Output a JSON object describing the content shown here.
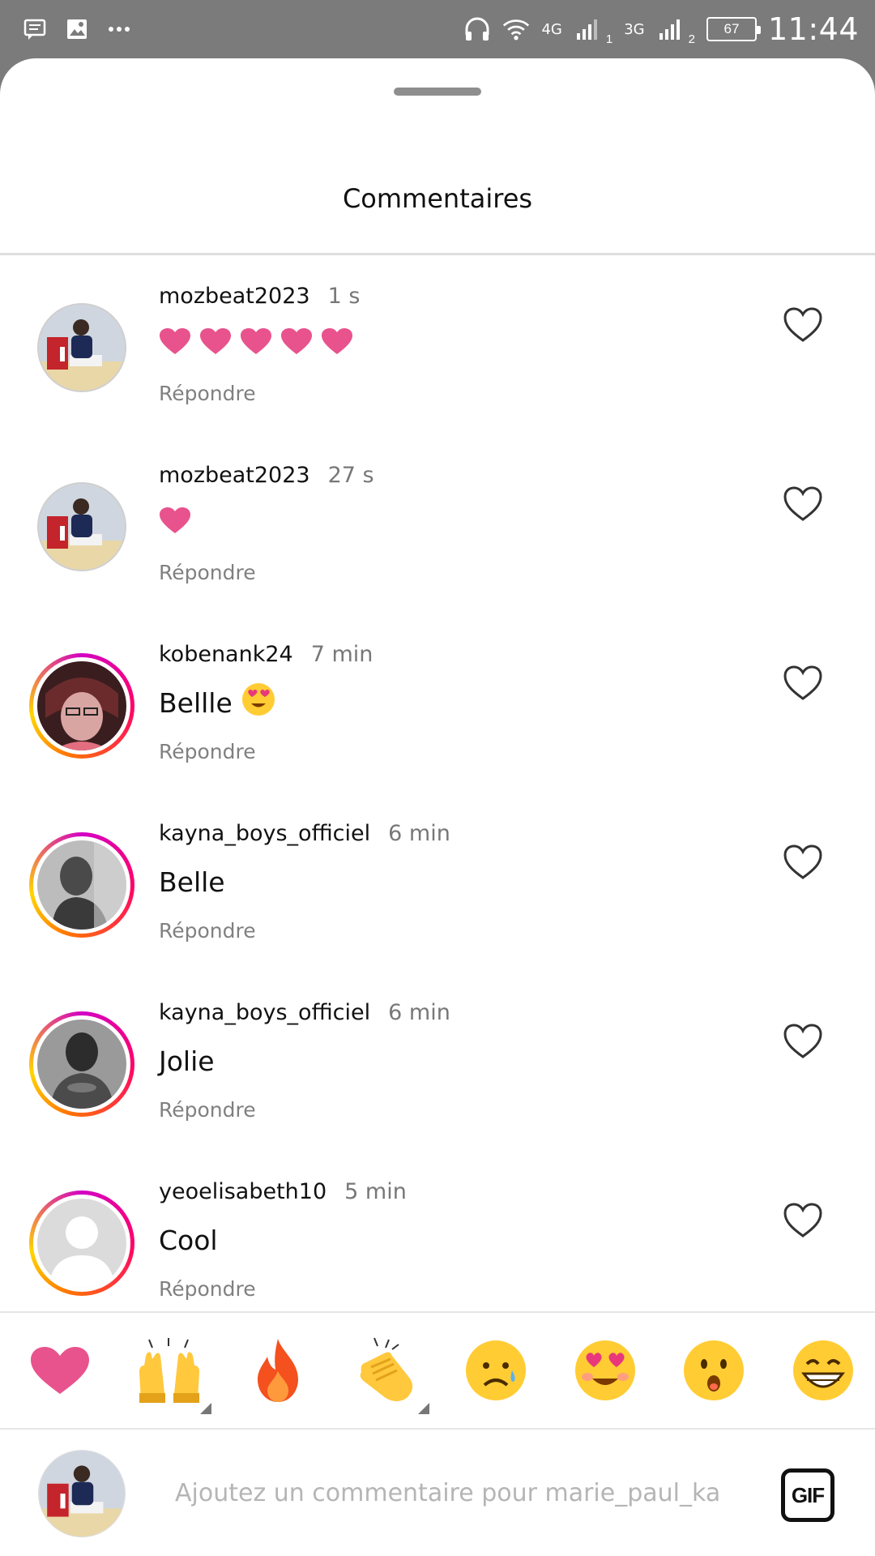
{
  "status_bar": {
    "network_1": "4G",
    "sim_1": "1",
    "network_2": "3G",
    "sim_2": "2",
    "battery": "67",
    "time": "11:44"
  },
  "sheet": {
    "title": "Commentaires"
  },
  "comments": [
    {
      "user": "mozbeat2023",
      "time": "1 s",
      "text": "",
      "hearts": 5,
      "emoji": "",
      "reply": "Répondre",
      "avatar": "photo-man-red-chair",
      "story_ring": false
    },
    {
      "user": "mozbeat2023",
      "time": "27 s",
      "text": "",
      "hearts": 1,
      "emoji": "",
      "reply": "Répondre",
      "avatar": "photo-man-red-chair",
      "story_ring": false
    },
    {
      "user": "kobenank24",
      "time": "7 min",
      "text": "Bellle",
      "hearts": 0,
      "emoji": "heart-eyes",
      "reply": "Répondre",
      "avatar": "anime-portrait",
      "story_ring": true
    },
    {
      "user": "kayna_boys_officiel",
      "time": "6 min",
      "text": "Belle",
      "hearts": 0,
      "emoji": "",
      "reply": "Répondre",
      "avatar": "grayscale-portrait",
      "story_ring": true
    },
    {
      "user": "kayna_boys_officiel",
      "time": "6 min",
      "text": "Jolie",
      "hearts": 0,
      "emoji": "",
      "reply": "Répondre",
      "avatar": "grayscale-portrait",
      "story_ring": true
    },
    {
      "user": "yeoelisabeth10",
      "time": "5 min",
      "text": "Cool",
      "hearts": 0,
      "emoji": "",
      "reply": "Répondre",
      "avatar": "default-avatar",
      "story_ring": true
    }
  ],
  "reactions": [
    "heart",
    "raising-hands",
    "fire",
    "clapping-hands",
    "sad-tear",
    "heart-eyes",
    "surprised",
    "grinning-sweat"
  ],
  "composer": {
    "placeholder": "Ajoutez un commentaire pour marie_paul_ka",
    "gif_label": "GIF"
  },
  "colors": {
    "heart_pink": "#e8538d",
    "ring_start": "#d300c5",
    "ring_end": "#ffd600"
  }
}
